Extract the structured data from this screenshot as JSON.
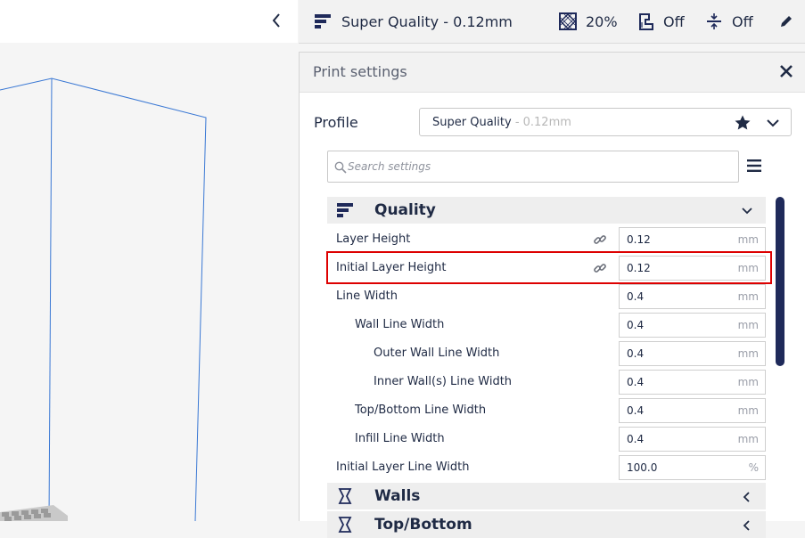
{
  "topbar": {
    "profile_label": "Super Quality - 0.12mm",
    "infill_label": "20%",
    "support_label": "Off",
    "adhesion_label": "Off",
    "icons": {
      "profile": "quality-bars-icon",
      "infill": "infill-pattern-icon",
      "support": "support-icon",
      "adhesion": "adhesion-icon",
      "edit": "pencil-icon"
    }
  },
  "left_header": {
    "collapse_icon": "chevron-left-icon"
  },
  "panel": {
    "title": "Print settings",
    "close_icon": "close-icon",
    "profile": {
      "label": "Profile",
      "selected_name": "Super Quality",
      "selected_suffix": "- 0.12mm"
    },
    "search": {
      "placeholder": "Search settings",
      "value": ""
    }
  },
  "categories": [
    {
      "label": "Quality",
      "icon": "quality-bars-icon",
      "expanded": true
    },
    {
      "label": "Walls",
      "icon": "walls-icon",
      "expanded": false
    },
    {
      "label": "Top/Bottom",
      "icon": "top-bottom-icon",
      "expanded": false
    }
  ],
  "settings": [
    {
      "label": "Layer Height",
      "value": "0.12",
      "unit": "mm",
      "linked": true,
      "indent": 0
    },
    {
      "label": "Initial Layer Height",
      "value": "0.12",
      "unit": "mm",
      "linked": true,
      "indent": 0,
      "highlighted": true
    },
    {
      "label": "Line Width",
      "value": "0.4",
      "unit": "mm",
      "linked": false,
      "indent": 0
    },
    {
      "label": "Wall Line Width",
      "value": "0.4",
      "unit": "mm",
      "linked": false,
      "indent": 1
    },
    {
      "label": "Outer Wall Line Width",
      "value": "0.4",
      "unit": "mm",
      "linked": false,
      "indent": 2
    },
    {
      "label": "Inner Wall(s) Line Width",
      "value": "0.4",
      "unit": "mm",
      "linked": false,
      "indent": 2
    },
    {
      "label": "Top/Bottom Line Width",
      "value": "0.4",
      "unit": "mm",
      "linked": false,
      "indent": 1
    },
    {
      "label": "Infill Line Width",
      "value": "0.4",
      "unit": "mm",
      "linked": false,
      "indent": 1
    },
    {
      "label": "Initial Layer Line Width",
      "value": "100.0",
      "unit": "%",
      "linked": false,
      "indent": 0
    }
  ],
  "colors": {
    "accent": "#1f2a5a",
    "highlight_box": "#dd0000",
    "build_volume_lines": "#3a78d4"
  }
}
